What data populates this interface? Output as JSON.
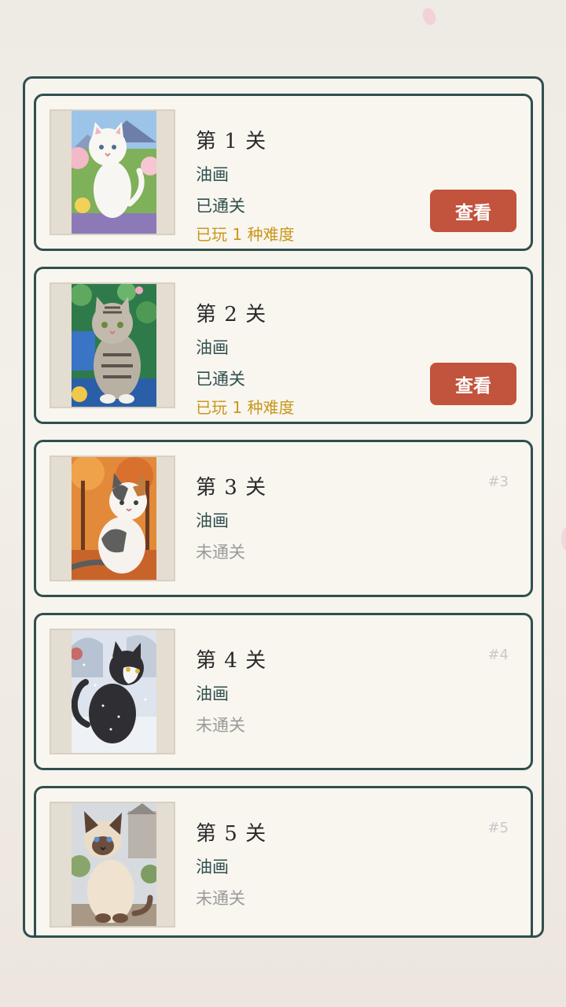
{
  "levels": [
    {
      "title": "第 1 关",
      "style": "油画",
      "status": "已通关",
      "played": "已玩 1 种难度",
      "button": "查看",
      "art": "white-cat-blossoms"
    },
    {
      "title": "第 2 关",
      "style": "油画",
      "status": "已通关",
      "played": "已玩 1 种难度",
      "button": "查看",
      "art": "tabby-cat-lily-pond"
    },
    {
      "title": "第 3 关",
      "style": "油画",
      "status": "未通关",
      "index": "#3",
      "art": "calico-cat-autumn"
    },
    {
      "title": "第 4 关",
      "style": "油画",
      "status": "未通关",
      "index": "#4",
      "art": "tuxedo-cat-snow"
    },
    {
      "title": "第 5 关",
      "style": "油画",
      "status": "未通关",
      "index": "#5",
      "art": "siamese-cat-garden"
    }
  ],
  "colors": {
    "panel_border": "#2f4f4d",
    "button": "#c2533d",
    "played_text": "#c8981c",
    "locked_text": "#9a9a9a"
  }
}
